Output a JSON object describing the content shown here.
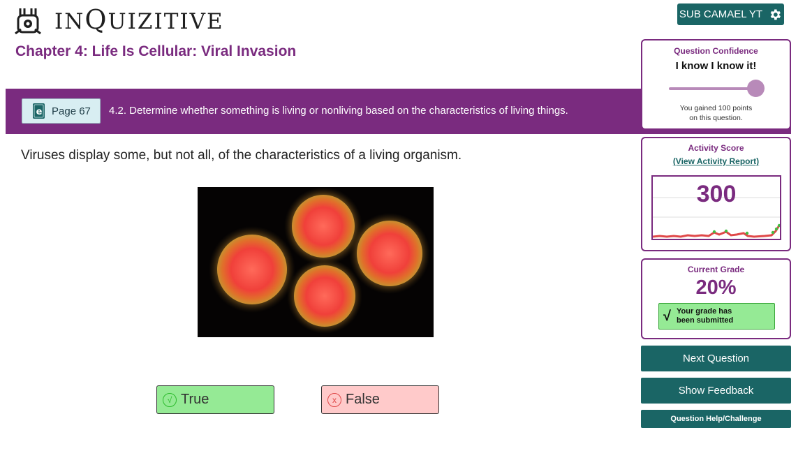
{
  "header": {
    "logo_text_prefix": "IN",
    "logo_text_q": "Q",
    "logo_text_suffix": "UIZITIVE",
    "user_button": "SUB CAMAEL YT"
  },
  "chapter_title": "Chapter 4: Life Is Cellular: Viral Invasion",
  "objective": {
    "page_label": "Page 67",
    "text": "4.2. Determine whether something is living or nonliving based on the characteristics of living things."
  },
  "question": {
    "text": "Viruses display some, but not all, of the characteristics of a living organism."
  },
  "answers": {
    "true_label": "True",
    "false_label": "False"
  },
  "confidence": {
    "title": "Question Confidence",
    "value": "I know I know it!",
    "level": 1.0,
    "note_line1": "You gained 100 points",
    "note_line2": "on this question."
  },
  "activity": {
    "title": "Activity Score",
    "link": "(View Activity Report)",
    "score": "300"
  },
  "grade": {
    "title": "Current Grade",
    "value": "20%",
    "submitted_line1": "Your grade has",
    "submitted_line2": "been submitted"
  },
  "buttons": {
    "next": "Next Question",
    "feedback": "Show Feedback",
    "help": "Question Help/Challenge"
  },
  "colors": {
    "brand_purple": "#7a2b7f",
    "teal": "#1a6565",
    "correct_green": "#95ea95",
    "wrong_pink": "#ffcaca"
  },
  "icons": {
    "logo": "inquizitive-bunny-logo",
    "settings": "gear-icon",
    "ebook": "ebook-icon",
    "true_mark": "check-circle-icon",
    "false_mark": "x-circle-icon"
  }
}
